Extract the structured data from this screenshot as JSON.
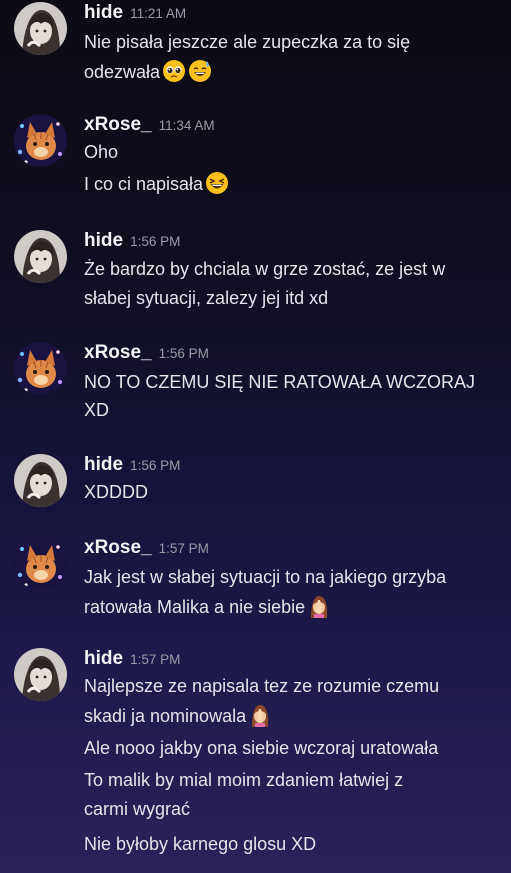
{
  "messages": [
    {
      "author": "hide",
      "time": "11:21 AM",
      "lines": [
        "Nie pisała jeszcze ale zupeczka za to się",
        "odezwała"
      ]
    },
    {
      "author": "xRose_",
      "time": "11:34 AM",
      "lines": [
        "Oho",
        "I co ci napisała"
      ]
    },
    {
      "author": "hide",
      "time": "1:56 PM",
      "lines": [
        "Że bardzo by chciala w grze zostać, ze jest w",
        "słabej sytuacji, zalezy jej itd xd"
      ]
    },
    {
      "author": "xRose_",
      "time": "1:56 PM",
      "lines": [
        "NO TO CZEMU SIĘ NIE RATOWAŁA WCZORAJ",
        "XD"
      ]
    },
    {
      "author": "hide",
      "time": "1:56 PM",
      "lines": [
        "XDDDD"
      ]
    },
    {
      "author": "xRose_",
      "time": "1:57 PM",
      "lines": [
        "Jak jest w słabej sytuacji to na jakiego grzyba",
        "ratowała Malika a nie siebie"
      ]
    },
    {
      "author": "hide",
      "time": "1:57 PM",
      "lines": [
        "Najlepsze ze napisala tez ze rozumie czemu",
        "skadi ja nominowala",
        "Ale nooo jakby ona siebie wczoraj uratowała",
        "To malik by mial moim zdaniem łatwiej z",
        "carmi wygrać",
        "Nie byłoby karnego glosu XD"
      ]
    }
  ],
  "emojis": {
    "pleading": "pleading-face-emoji",
    "sweat_smile": "grinning-sweat-emoji",
    "laughing": "laughing-face-emoji",
    "facepalm": "woman-facepalming-emoji"
  },
  "colors": {
    "username": "#f2f3f5",
    "timestamp": "#9a9aa8",
    "text": "#e4e4ea"
  }
}
